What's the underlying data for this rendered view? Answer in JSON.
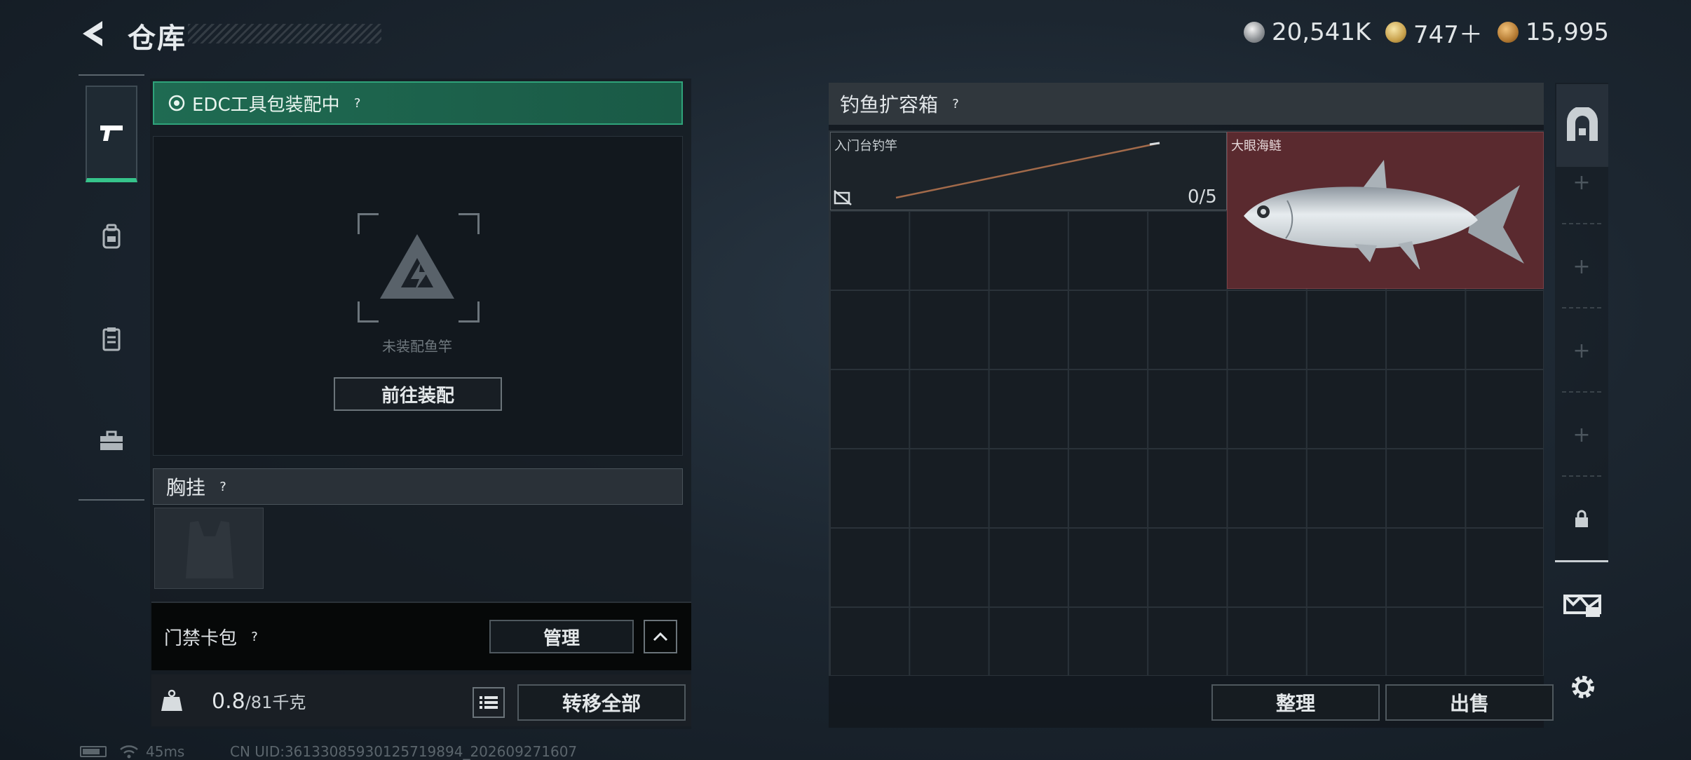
{
  "header": {
    "title": "仓库",
    "currencies": [
      {
        "icon": "silver-coin-icon",
        "value": "20,541K"
      },
      {
        "icon": "gold-coin-icon",
        "value": "747＋"
      },
      {
        "icon": "bronze-coin-icon",
        "value": "15,995"
      }
    ]
  },
  "left_tabs": [
    {
      "icon": "pistol-icon",
      "active": true
    },
    {
      "icon": "backpack-icon",
      "active": false
    },
    {
      "icon": "clipboard-icon",
      "active": false
    },
    {
      "icon": "toolbox-icon",
      "active": false
    }
  ],
  "edc": {
    "label": "EDC工具包装配中",
    "help": "?"
  },
  "rod_slot": {
    "empty_text": "未装配鱼竿",
    "goto_label": "前往装配"
  },
  "chest": {
    "label": "胸挂",
    "help": "?"
  },
  "card_pack": {
    "label": "门禁卡包",
    "help": "?",
    "manage_label": "管理"
  },
  "weight": {
    "current": "0.8",
    "max": "/81千克",
    "transfer_label": "转移全部"
  },
  "fishing_box": {
    "title": "钓鱼扩容箱",
    "help": "?",
    "items": [
      {
        "name": "入门台钓竿",
        "count": "0/5"
      },
      {
        "name": "大眼海鲢"
      }
    ],
    "sort_label": "整理",
    "sell_label": "出售"
  },
  "side_slots": {
    "plus": "+"
  },
  "status": {
    "ping": "45ms",
    "uid": "CN UID:36133085930125719894_202609271607"
  },
  "colors": {
    "accent_green": "#36c48b",
    "fish_bg": "#5a2a2f"
  }
}
